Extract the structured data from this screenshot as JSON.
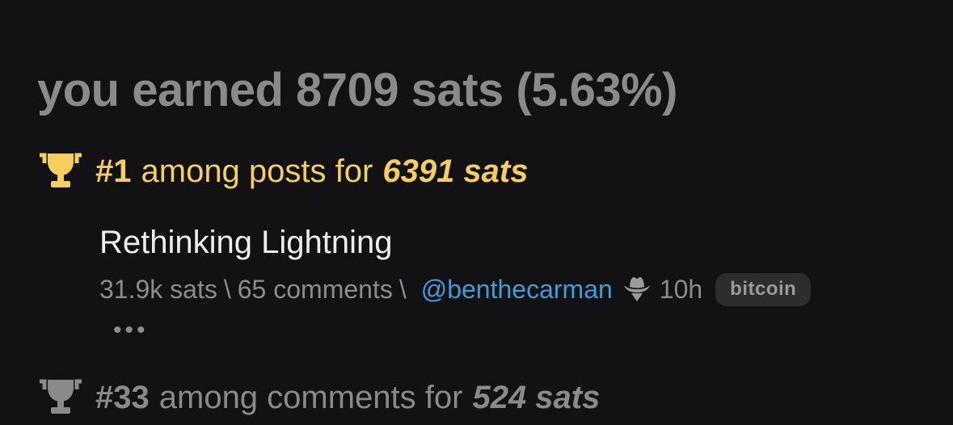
{
  "summary": {
    "headline": "you earned 8709 sats (5.63%)"
  },
  "rankings": [
    {
      "rank": "#1",
      "category_text": "among posts for",
      "sats": "6391 sats",
      "accent": "#f5cf5b"
    },
    {
      "rank": "#33",
      "category_text": "among comments for",
      "sats": "524 sats",
      "accent": "#8a8a8c"
    }
  ],
  "post": {
    "title": "Rethinking Lightning",
    "sats": "31.9k sats",
    "separator": "\\",
    "comments": "65 comments",
    "user": "@benthecarman",
    "age": "10h",
    "tag": "bitcoin",
    "more": "•••"
  },
  "icons": {
    "trophy": "trophy-icon",
    "user_hat": "cowboy-hat-icon"
  },
  "colors": {
    "background": "#121214",
    "link": "#3d9ed8",
    "gold": "#f5cf5b"
  }
}
